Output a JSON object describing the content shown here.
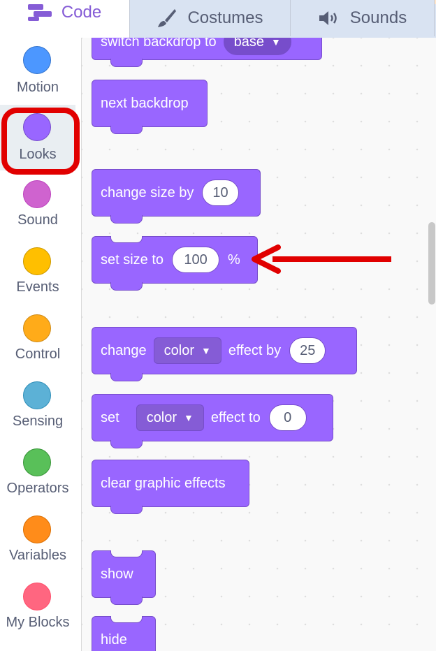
{
  "tabs": [
    {
      "label": "Code",
      "icon": "code-icon",
      "active": true
    },
    {
      "label": "Costumes",
      "icon": "brush-icon",
      "active": false
    },
    {
      "label": "Sounds",
      "icon": "speaker-icon",
      "active": false
    }
  ],
  "categories": [
    {
      "label": "Motion",
      "color": "#4c97ff"
    },
    {
      "label": "Looks",
      "color": "#9966ff",
      "selected": true
    },
    {
      "label": "Sound",
      "color": "#cf63cf"
    },
    {
      "label": "Events",
      "color": "#ffbf00"
    },
    {
      "label": "Control",
      "color": "#ffab19"
    },
    {
      "label": "Sensing",
      "color": "#5cb1d6"
    },
    {
      "label": "Operators",
      "color": "#59c059"
    },
    {
      "label": "Variables",
      "color": "#ff8c1a"
    },
    {
      "label": "My Blocks",
      "color": "#ff6680"
    }
  ],
  "blocks": {
    "switch_backdrop": {
      "text": "switch backdrop to",
      "value": "base"
    },
    "next_backdrop": {
      "text": "next backdrop"
    },
    "change_size": {
      "text": "change size by",
      "value": "10"
    },
    "set_size": {
      "text": "set size to",
      "value": "100",
      "suffix": "%"
    },
    "change_effect": {
      "text1": "change",
      "dropdown": "color",
      "text2": "effect by",
      "value": "25"
    },
    "set_effect": {
      "text1": "set",
      "dropdown": "color",
      "text2": "effect to",
      "value": "0"
    },
    "clear_effects": {
      "text": "clear graphic effects"
    },
    "show": {
      "text": "show"
    },
    "hide": {
      "text": "hide"
    }
  },
  "colors": {
    "looks": "#9966ff",
    "highlight": "#e10000",
    "accent": "#855cd6"
  }
}
